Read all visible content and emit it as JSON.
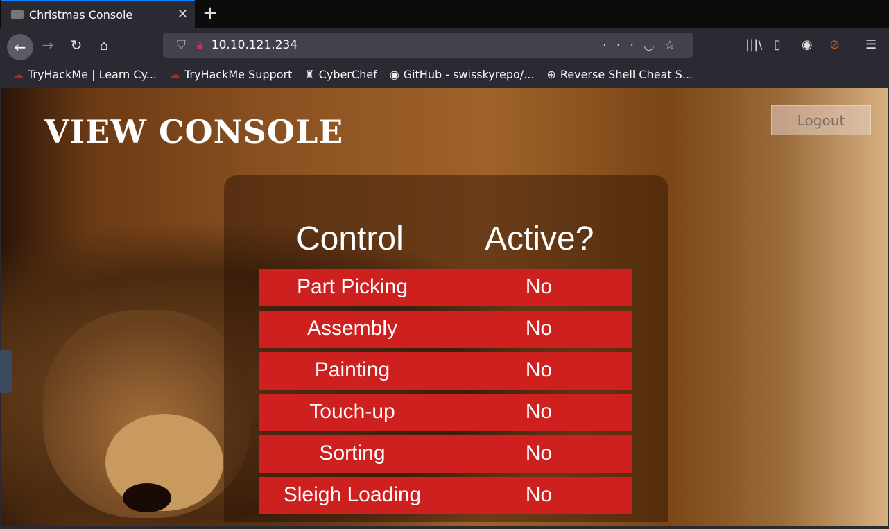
{
  "browser": {
    "tab_title": "Christmas Console",
    "url": "10.10.121.234",
    "bookmarks": [
      "TryHackMe | Learn Cy...",
      "TryHackMe Support",
      "CyberChef",
      "GitHub - swisskyrepo/...",
      "Reverse Shell Cheat S..."
    ]
  },
  "page": {
    "title": "VIEW CONSOLE",
    "logout_label": "Logout",
    "headers": {
      "control": "Control",
      "active": "Active?"
    },
    "rows": [
      {
        "control": "Part Picking",
        "active": "No"
      },
      {
        "control": "Assembly",
        "active": "No"
      },
      {
        "control": "Painting",
        "active": "No"
      },
      {
        "control": "Touch-up",
        "active": "No"
      },
      {
        "control": "Sorting",
        "active": "No"
      },
      {
        "control": "Sleigh Loading",
        "active": "No"
      }
    ],
    "row_color": "#cf2020"
  }
}
